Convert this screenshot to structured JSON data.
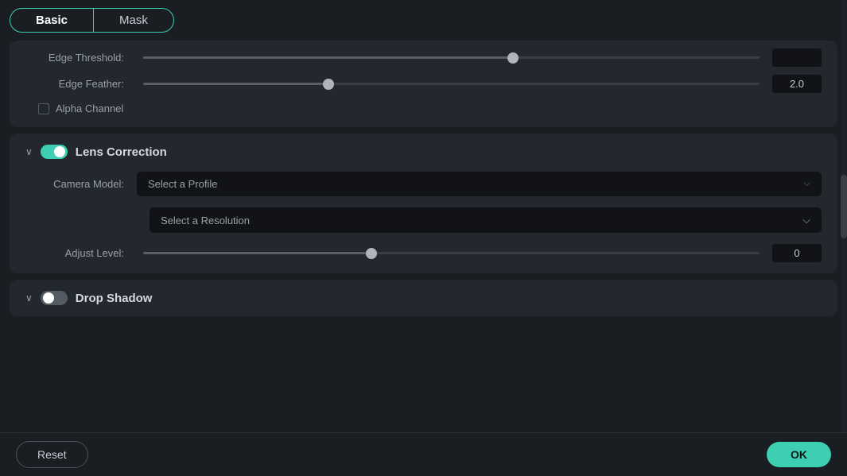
{
  "tabs": [
    {
      "id": "basic",
      "label": "Basic",
      "active": true
    },
    {
      "id": "mask",
      "label": "Mask",
      "active": false
    }
  ],
  "edge_section": {
    "edge_threshold_label": "Edge Threshold:",
    "edge_threshold_value": "",
    "edge_feather_label": "Edge Feather:",
    "edge_feather_value": "2.0",
    "alpha_channel_label": "Alpha Channel",
    "edge_feather_slider_pct": 30
  },
  "lens_correction": {
    "title": "Lens Correction",
    "camera_model_label": "Camera Model:",
    "camera_model_placeholder": "Select a Profile",
    "resolution_placeholder": "Select a Resolution",
    "adjust_level_label": "Adjust Level:",
    "adjust_level_value": "0",
    "adjust_slider_pct": 37
  },
  "drop_shadow": {
    "title": "Drop Shadow"
  },
  "footer": {
    "reset_label": "Reset",
    "ok_label": "OK"
  }
}
